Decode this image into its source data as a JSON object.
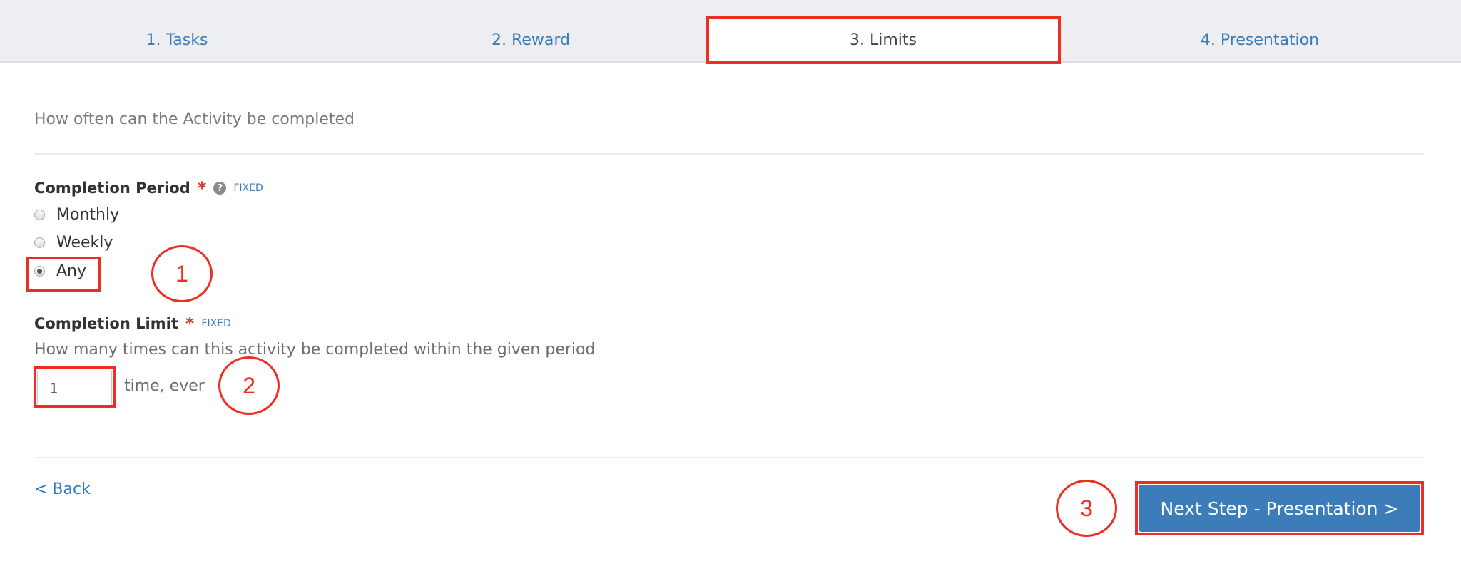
{
  "wizard_tabs": [
    {
      "label": "1. Tasks",
      "active": false
    },
    {
      "label": "2. Reward",
      "active": false
    },
    {
      "label": "3. Limits",
      "active": true
    },
    {
      "label": "4. Presentation",
      "active": false
    }
  ],
  "section": {
    "subtitle": "How often can the Activity be completed"
  },
  "completion_period": {
    "label": "Completion Period",
    "required_mark": "*",
    "help_icon": "question-circle-icon",
    "help_glyph": "?",
    "badge": "FIXED",
    "options": [
      {
        "label": "Monthly",
        "checked": false
      },
      {
        "label": "Weekly",
        "checked": false
      },
      {
        "label": "Any",
        "checked": true
      }
    ],
    "selected": "Any"
  },
  "completion_limit": {
    "label": "Completion Limit",
    "required_mark": "*",
    "badge": "FIXED",
    "help_text": "How many times can this activity be completed within the given period",
    "value": "1",
    "suffix": "time, ever"
  },
  "footer": {
    "back_label": "< Back",
    "next_label": "Next Step - Presentation >"
  },
  "annotations": {
    "step1": "1",
    "step2": "2",
    "step3": "3",
    "color": "#ee2d24"
  },
  "colors": {
    "link": "#3a7bb8",
    "primary_button": "#3c7db9",
    "required": "#d9372b",
    "tabbar_bg": "#eceef1"
  }
}
